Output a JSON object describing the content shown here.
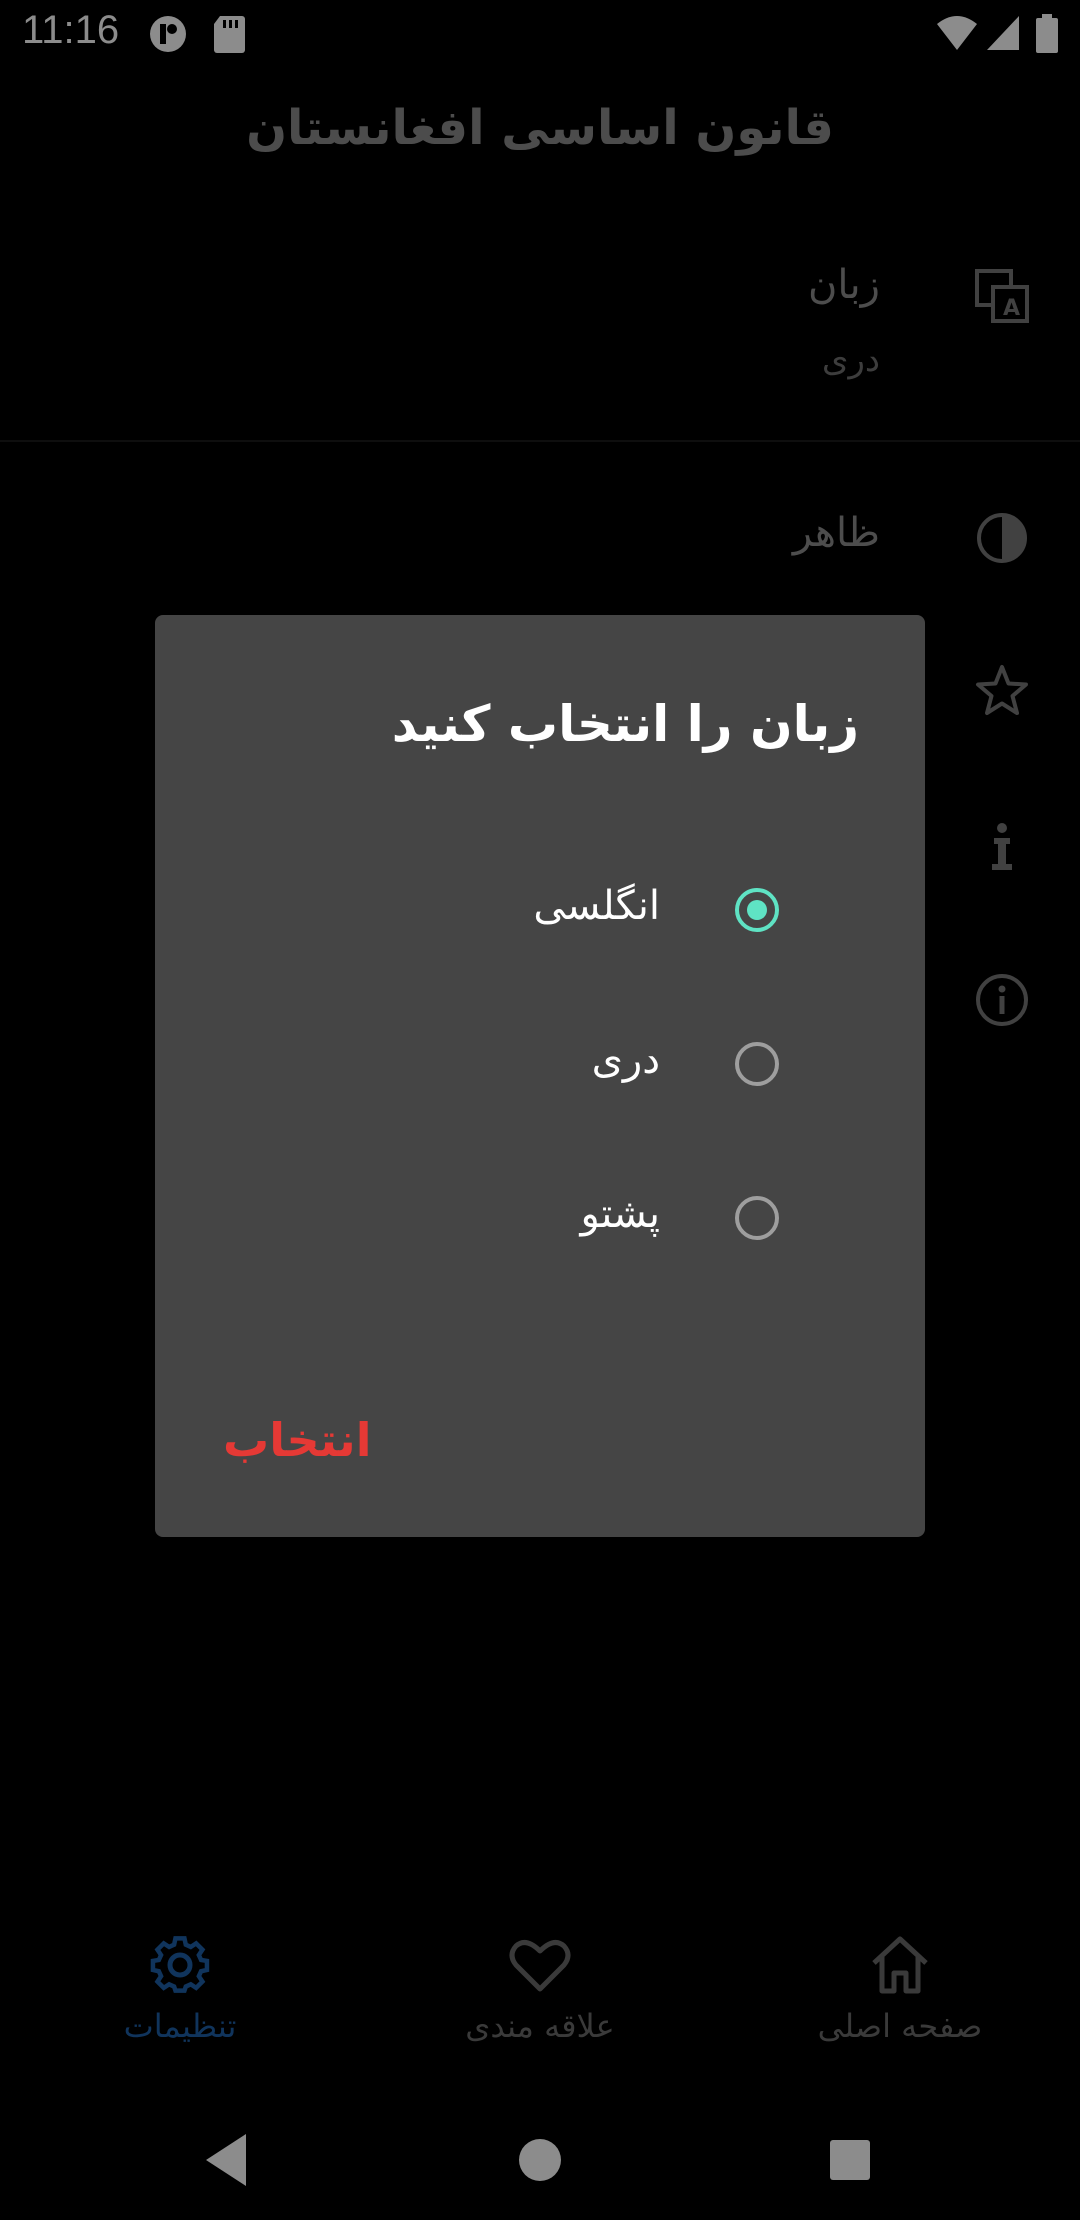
{
  "status_bar": {
    "time": "11:16"
  },
  "app": {
    "title": "قانون اساسی افغانستان"
  },
  "settings": {
    "language": {
      "label": "زبان",
      "value": "دری"
    },
    "appearance": {
      "label": "ظاهر"
    }
  },
  "dialog": {
    "title": "زبان را انتخاب کنید",
    "options": [
      {
        "label": "انگلسی",
        "selected": true
      },
      {
        "label": "دری",
        "selected": false
      },
      {
        "label": "پشتو",
        "selected": false
      }
    ],
    "action_label": "انتخاب"
  },
  "bottom_nav": {
    "settings_label": "تنظیمات",
    "favorites_label": "علاقه مندی",
    "home_label": "صفحه اصلی",
    "active": "settings"
  },
  "colors": {
    "accent_radio": "#5fe3c4",
    "action": "#e53935",
    "nav_active": "#1e5fa8",
    "nav_inactive": "#6b6b6b"
  }
}
